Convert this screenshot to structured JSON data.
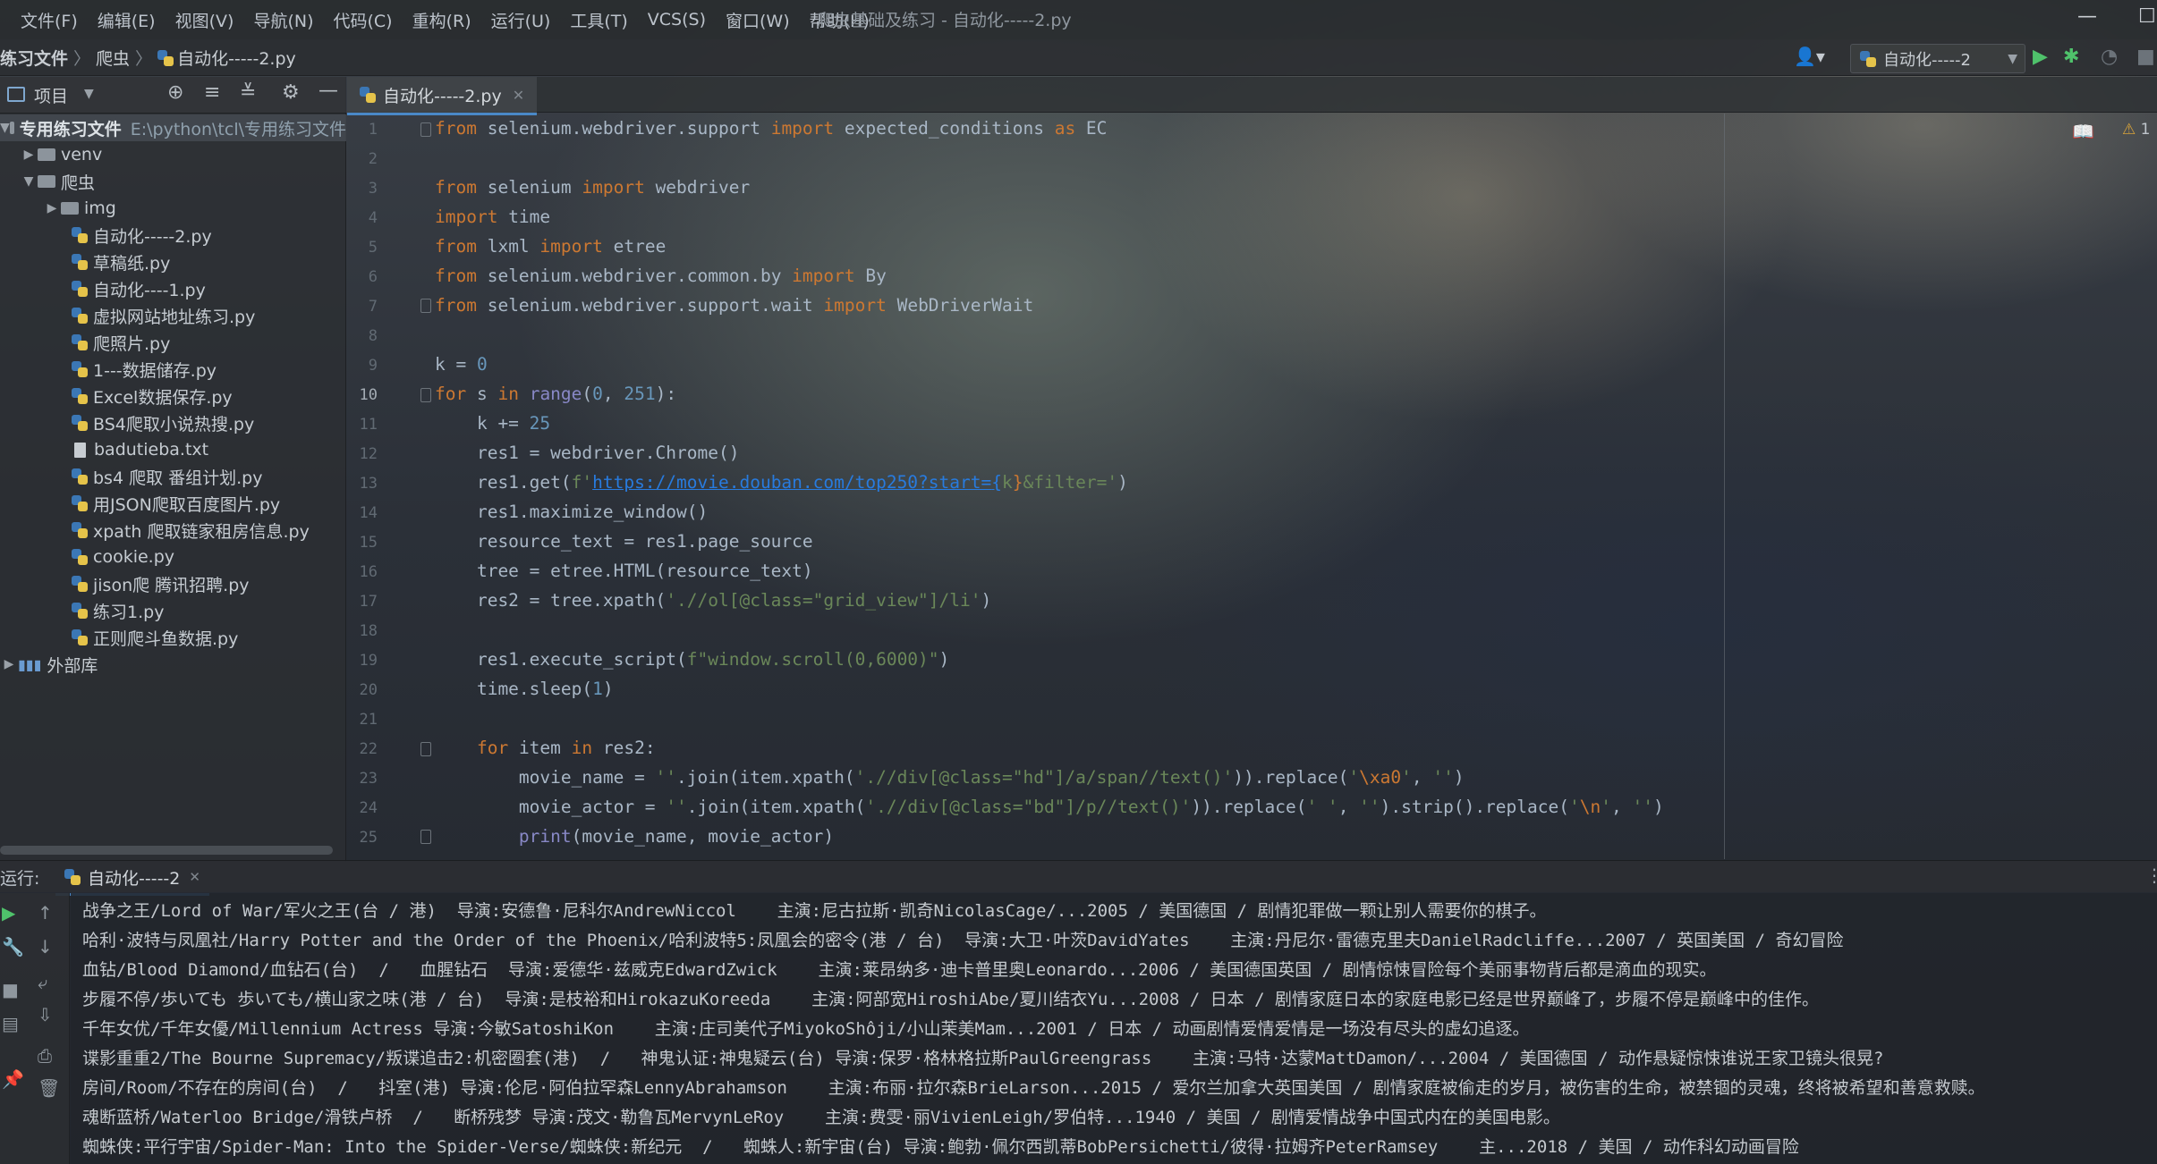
{
  "menu": {
    "items": [
      "文件(F)",
      "编辑(E)",
      "视图(V)",
      "导航(N)",
      "代码(C)",
      "重构(R)",
      "运行(U)",
      "工具(T)",
      "VCS(S)",
      "窗口(W)",
      "帮助(H)"
    ],
    "window_title": "爬虫基础及练习 - 自动化-----2.py"
  },
  "breadcrumb": {
    "project": "练习文件",
    "folder": "爬虫",
    "file": "自动化-----2.py"
  },
  "toolbar": {
    "run_config": "自动化-----2"
  },
  "project_panel": {
    "title": "项目",
    "root_name": "专用练习文件",
    "root_path": "E:\\python\\tcl\\专用练习文件",
    "venv": "venv",
    "folder": "爬虫",
    "img_folder": "img",
    "files": [
      "自动化-----2.py",
      "草稿纸.py",
      "自动化----1.py",
      "虚拟网站地址练习.py",
      "爬照片.py",
      "1---数据储存.py",
      "Excel数据保存.py",
      "BS4爬取小说热搜.py",
      "badutieba.txt",
      "bs4 爬取 番组计划.py",
      "用JSON爬取百度图片.py",
      "xpath 爬取链家租房信息.py",
      "cookie.py",
      "jison爬 腾讯招聘.py",
      "练习1.py",
      "正则爬斗鱼数据.py"
    ],
    "external_libs": "外部库"
  },
  "editor": {
    "tab": "自动化-----2.py",
    "current_line": 10,
    "warnings": "1",
    "lines": [
      {
        "n": "1",
        "c": "from selenium.webdriver.support import expected_conditions as EC"
      },
      {
        "n": "2",
        "c": ""
      },
      {
        "n": "3",
        "c": "from selenium import webdriver"
      },
      {
        "n": "4",
        "c": "import time"
      },
      {
        "n": "5",
        "c": "from lxml import etree"
      },
      {
        "n": "6",
        "c": "from selenium.webdriver.common.by import By"
      },
      {
        "n": "7",
        "c": "from selenium.webdriver.support.wait import WebDriverWait"
      },
      {
        "n": "8",
        "c": ""
      },
      {
        "n": "9",
        "c": "k = 0"
      },
      {
        "n": "10",
        "c": "for s in range(0, 251):"
      },
      {
        "n": "11",
        "c": "    k += 25"
      },
      {
        "n": "12",
        "c": "    res1 = webdriver.Chrome()"
      },
      {
        "n": "13",
        "c": "    res1.get(f'https://movie.douban.com/top250?start={k}&filter=')"
      },
      {
        "n": "14",
        "c": "    res1.maximize_window()"
      },
      {
        "n": "15",
        "c": "    resource_text = res1.page_source"
      },
      {
        "n": "16",
        "c": "    tree = etree.HTML(resource_text)"
      },
      {
        "n": "17",
        "c": "    res2 = tree.xpath('.//ol[@class=\"grid_view\"]/li')"
      },
      {
        "n": "18",
        "c": ""
      },
      {
        "n": "19",
        "c": "    res1.execute_script(f\"window.scroll(0,6000)\")"
      },
      {
        "n": "20",
        "c": "    time.sleep(1)"
      },
      {
        "n": "21",
        "c": ""
      },
      {
        "n": "22",
        "c": "    for item in res2:"
      },
      {
        "n": "23",
        "c": "        movie_name = ''.join(item.xpath('.//div[@class=\"hd\"]/a/span//text()')).replace('\\xa0', '')"
      },
      {
        "n": "24",
        "c": "        movie_actor = ''.join(item.xpath('.//div[@class=\"bd\"]/p//text()')).replace(' ', '').strip().replace('\\n', '')"
      },
      {
        "n": "25",
        "c": "        print(movie_name, movie_actor)"
      }
    ]
  },
  "run": {
    "label": "运行:",
    "tab": "自动化-----2",
    "output": [
      "战争之王/Lord of War/军火之王(台 / 港)  导演:安德鲁·尼科尔AndrewNiccol    主演:尼古拉斯·凯奇NicolasCage/...2005 / 美国德国 / 剧情犯罪做一颗让别人需要你的棋子。",
      "哈利·波特与凤凰社/Harry Potter and the Order of the Phoenix/哈利波特5:凤凰会的密令(港 / 台)  导演:大卫·叶茨DavidYates    主演:丹尼尔·雷德克里夫DanielRadcliffe...2007 / 英国美国 / 奇幻冒险",
      "血钻/Blood Diamond/血钻石(台)  /   血腥钻石  导演:爱德华·兹威克EdwardZwick    主演:莱昂纳多·迪卡普里奥Leonardo...2006 / 美国德国英国 / 剧情惊悚冒险每个美丽事物背后都是滴血的现实。",
      "步履不停/歩いても 歩いても/横山家之味(港 / 台)  导演:是枝裕和HirokazuKoreeda    主演:阿部宽HiroshiAbe/夏川结衣Yu...2008 / 日本 / 剧情家庭日本的家庭电影已经是世界巅峰了，步履不停是巅峰中的佳作。",
      "千年女优/千年女優/Millennium Actress 导演:今敏SatoshiKon    主演:庄司美代子MiyokoShôji/小山茉美Mam...2001 / 日本 / 动画剧情爱情爱情是一场没有尽头的虚幻追逐。",
      "谍影重重2/The Bourne Supremacy/叛谍追击2:机密圈套(港)  /   神鬼认证:神鬼疑云(台) 导演:保罗·格林格拉斯PaulGreengrass    主演:马特·达蒙MattDamon/...2004 / 美国德国 / 动作悬疑惊悚谁说王家卫镜头很晃?",
      "房间/Room/不存在的房间(台)  /   抖室(港) 导演:伦尼·阿伯拉罕森LennyAbrahamson    主演:布丽·拉尔森BrieLarson...2015 / 爱尔兰加拿大英国美国 / 剧情家庭被偷走的岁月，被伤害的生命，被禁锢的灵魂，终将被希望和善意救赎。",
      "魂断蓝桥/Waterloo Bridge/滑铁卢桥  /   断桥残梦 导演:茂文·勒鲁瓦MervynLeRoy    主演:费雯·丽VivienLeigh/罗伯特...1940 / 美国 / 剧情爱情战争中国式内在的美国电影。",
      "蜘蛛侠:平行宇宙/Spider-Man: Into the Spider-Verse/蜘蛛侠:新纪元  /   蜘蛛人:新宇宙(台) 导演:鲍勃·佩尔西凯蒂BobPersichetti/彼得·拉姆齐PeterRamsey    主...2018 / 美国 / 动作科幻动画冒险"
    ]
  },
  "colors": {
    "keyword": "#cc7832",
    "string": "#6a8759",
    "number": "#6897bb",
    "link": "#287bde",
    "builtin": "#8888c6",
    "accent": "#4a88c7",
    "run_green": "#4fc26b"
  }
}
